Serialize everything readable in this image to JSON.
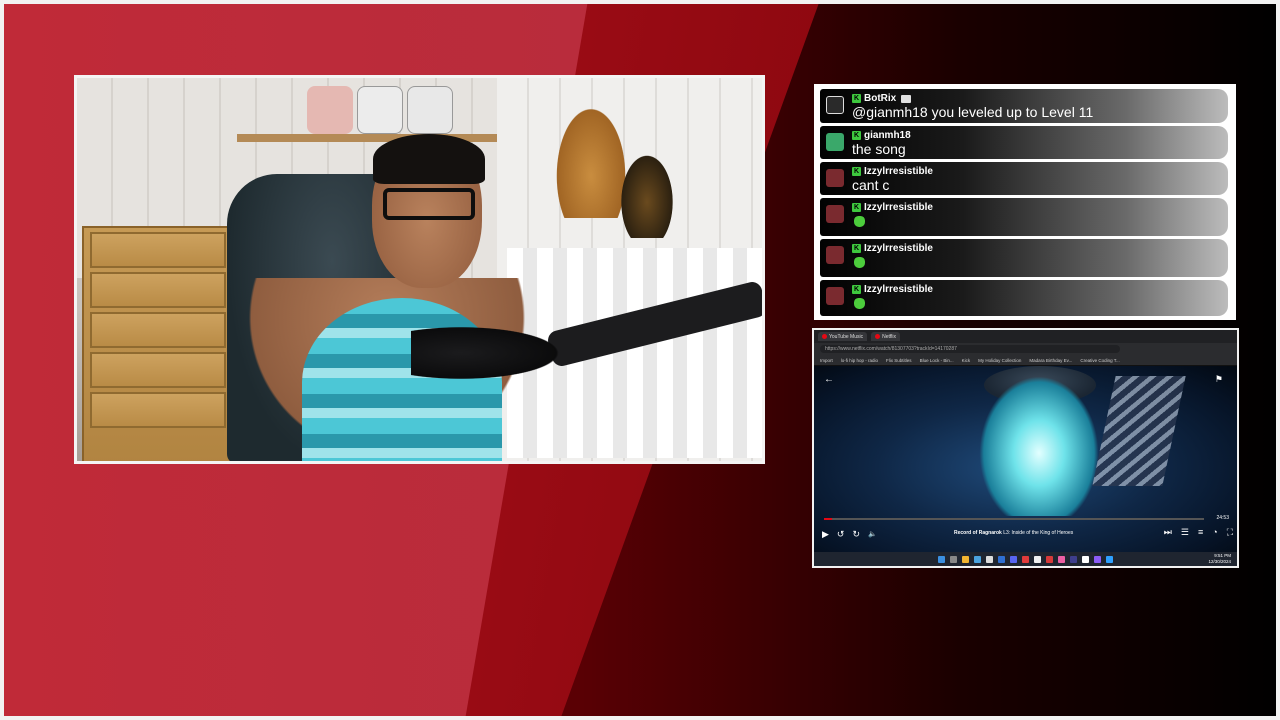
{
  "chat": {
    "messages": [
      {
        "user": "BotRix",
        "text": "@gianmh18 you leveled up to Level 11",
        "bot": true,
        "avatar_color": "#222222"
      },
      {
        "user": "gianmh18",
        "text": "the song",
        "bot": false,
        "avatar_color": "#3aa86a"
      },
      {
        "user": "Izzylrresistible",
        "text": "cant c",
        "bot": false,
        "avatar_color": "#7a2a2f"
      },
      {
        "user": "Izzylrresistible",
        "text": "",
        "emote": true,
        "bot": false,
        "avatar_color": "#7a2a2f"
      },
      {
        "user": "Izzylrresistible",
        "text": "",
        "emote": true,
        "bot": false,
        "avatar_color": "#7a2a2f"
      },
      {
        "user": "Izzylrresistible",
        "text": "",
        "emote": true,
        "bot": false,
        "avatar_color": "#7a2a2f"
      }
    ],
    "badge_color": "#3ec83e",
    "badge_letter": "K"
  },
  "screen": {
    "tabs": [
      "YouTube Music",
      "Netflix"
    ],
    "address": "https://www.netflix.com/watch/81307703?trackId=14170287",
    "bookmarks": [
      "Import",
      "lo-fi hip hop - radio",
      "Flix Subtitles",
      "Blue Lock - Bin...",
      "Kick",
      "My Holiday Collection",
      "Madara Birthday Ev...",
      "Creative Coding T..."
    ],
    "video_title_bold": "Record of Ragnarok",
    "video_title_rest": "L3: Inside of the King of Heroes",
    "time_left": "24:53",
    "progress": 0.02,
    "clock_time": "9:51 PM",
    "clock_date": "12/30/2024",
    "netflix_red": "#e50914"
  },
  "icons": {
    "back": "←",
    "flag": "⚑",
    "play": "▶",
    "rewind": "↺",
    "forward": "↻",
    "volume": "🔈",
    "next": "⏭",
    "episodes": "☰",
    "subtitles": "≡",
    "speed": "◔",
    "fullscreen": "⛶"
  }
}
